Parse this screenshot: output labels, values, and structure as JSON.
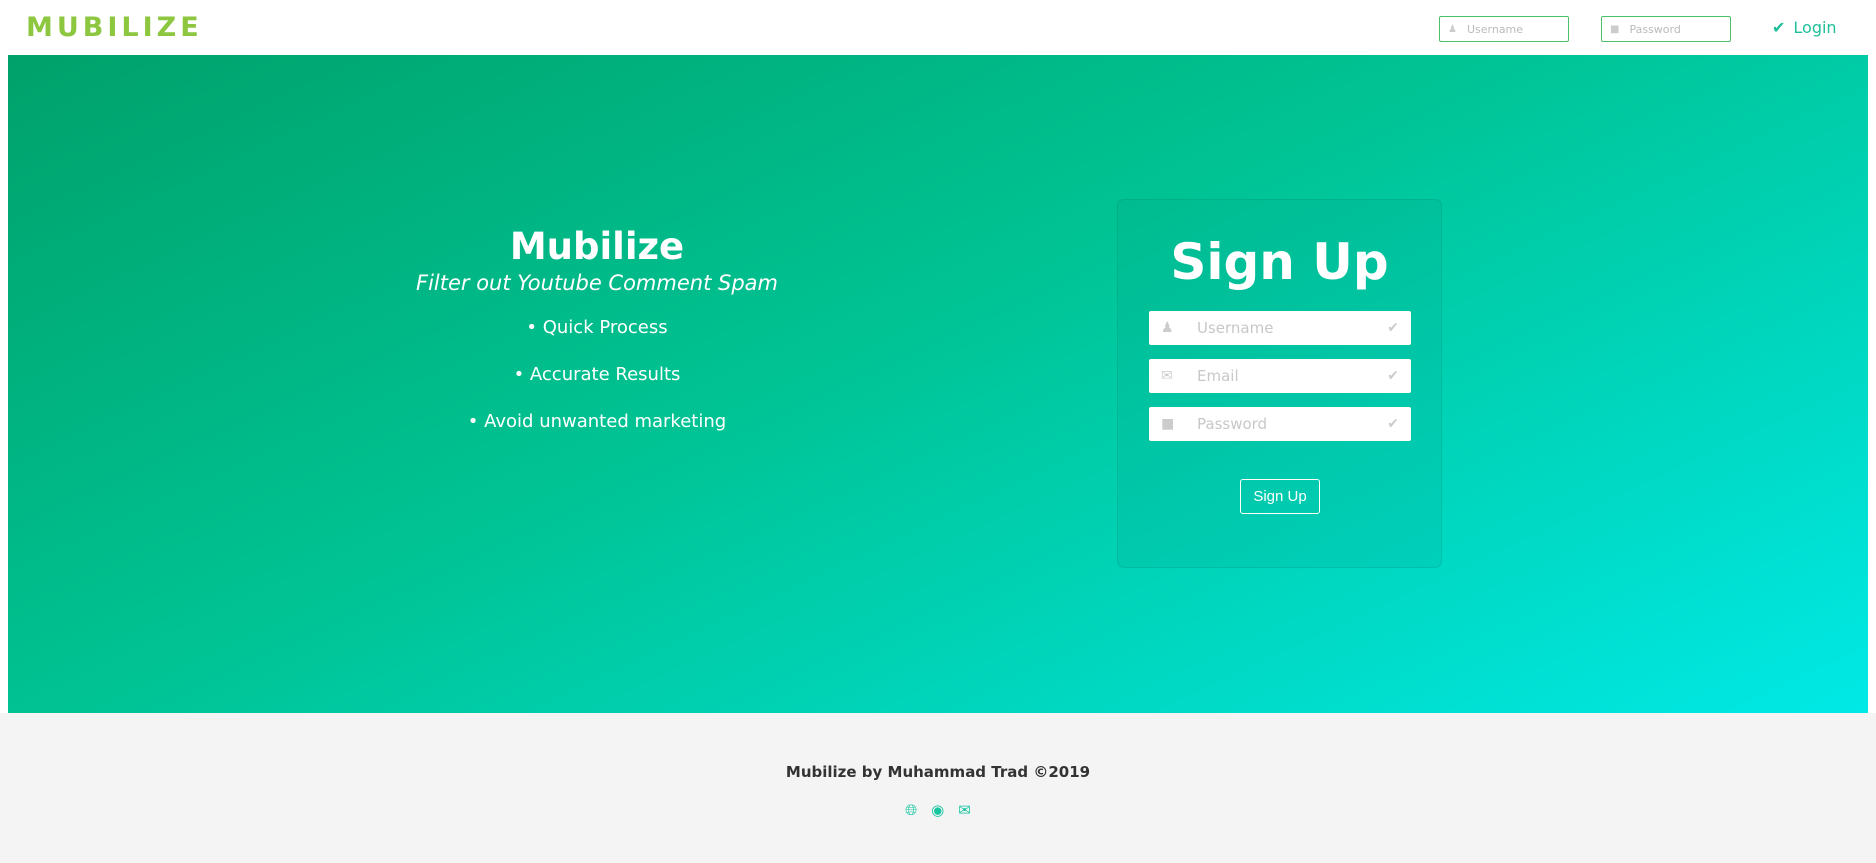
{
  "nav": {
    "logo": "MUBILIZE",
    "username_placeholder": "Username",
    "password_placeholder": "Password",
    "login_label": "Login"
  },
  "hero": {
    "title": "Mubilize",
    "subtitle": "Filter out Youtube Comment Spam",
    "bullets": [
      "• Quick Process",
      "• Accurate Results",
      "• Avoid unwanted marketing"
    ]
  },
  "signup": {
    "title": "Sign Up",
    "fields": [
      {
        "placeholder": "Username",
        "icon": "user-icon"
      },
      {
        "placeholder": "Email",
        "icon": "envelope-icon"
      },
      {
        "placeholder": "Password",
        "icon": "lock-icon"
      }
    ],
    "button": "Sign Up"
  },
  "footer": {
    "text": "Mubilize by Muhammad Trad ©2019",
    "icons": [
      "globe-icon",
      "github-icon",
      "envelope-icon"
    ]
  },
  "colors": {
    "brand": "#8dc63f",
    "accent": "#1fbf9a",
    "gradient_start": "#00a16a",
    "gradient_end": "#00e9e6"
  }
}
